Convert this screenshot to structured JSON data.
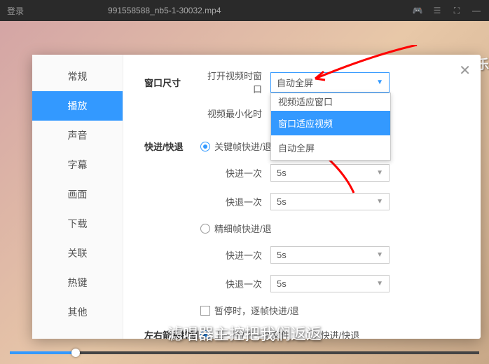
{
  "topbar": {
    "login": "登录",
    "filename": "991558588_nb5-1-30032.mp4"
  },
  "video": {
    "overlay_text": "Da圣音乐",
    "subtitle": "滤唱器主控把我们返返"
  },
  "sidebar": {
    "items": [
      {
        "label": "常规"
      },
      {
        "label": "播放"
      },
      {
        "label": "声音"
      },
      {
        "label": "字幕"
      },
      {
        "label": "画面"
      },
      {
        "label": "下载"
      },
      {
        "label": "关联"
      },
      {
        "label": "热键"
      },
      {
        "label": "其他"
      }
    ]
  },
  "settings": {
    "window_size_title": "窗口尺寸",
    "open_video_window": "打开视频时窗口",
    "auto_fullscreen": "自动全屏",
    "video_min": "视频最小化时",
    "dropdown": {
      "item0": "视频适应窗口",
      "item1": "窗口适应视频",
      "item2": "自动全屏"
    },
    "fastforward_title": "快进/快退",
    "keyframe_mode": "关键帧快进/退",
    "forward_once": "快进一次",
    "backward_once": "快退一次",
    "five_s": "5s",
    "frame_mode": "精细帧快进/退",
    "pause_frame": "暂停时，逐帧快进/退",
    "arrow_key_title": "左右箭头控制",
    "prev_next_file": "上一个/下一个文件",
    "ff_rw": "快进/快退"
  }
}
